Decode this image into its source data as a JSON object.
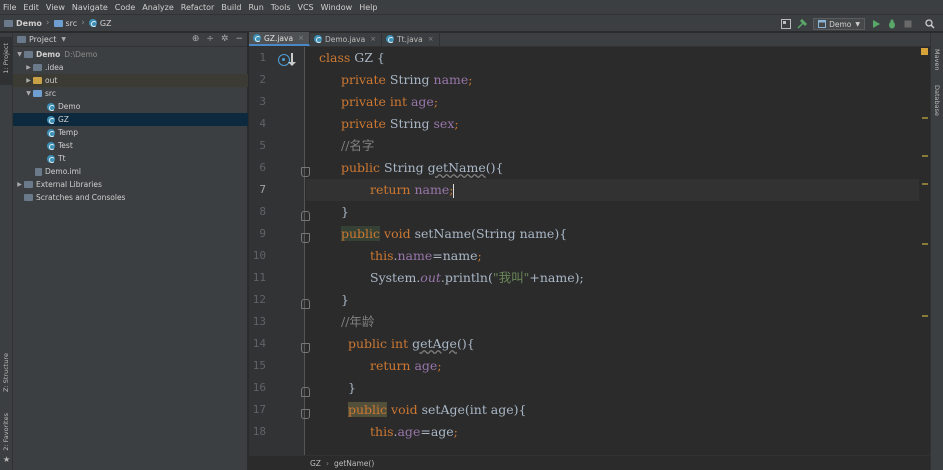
{
  "menu": [
    "File",
    "Edit",
    "View",
    "Navigate",
    "Code",
    "Analyze",
    "Refactor",
    "Build",
    "Run",
    "Tools",
    "VCS",
    "Window",
    "Help"
  ],
  "navbar": {
    "crumbs": [
      "Demo",
      "src",
      "GZ"
    ],
    "run_config": "Demo"
  },
  "left_stripe": {
    "project": "1: Project",
    "structure": "Z: Structure",
    "favorites": "2: Favorites"
  },
  "right_stripe": {
    "maven": "Maven",
    "database": "Database"
  },
  "project_panel": {
    "title": "Project",
    "tree": {
      "root": "Demo",
      "root_path": "D:\\Demo",
      "idea": ".idea",
      "out": "out",
      "src": "src",
      "files": [
        "Demo",
        "GZ",
        "Temp",
        "Test",
        "Tt"
      ],
      "iml": "Demo.iml",
      "ext": "External Libraries",
      "scratch": "Scratches and Consoles"
    }
  },
  "tabs": [
    "GZ.java",
    "Demo.java",
    "Tt.java"
  ],
  "line_numbers": [
    "1",
    "2",
    "3",
    "4",
    "5",
    "6",
    "7",
    "8",
    "9",
    "10",
    "11",
    "12",
    "13",
    "14",
    "15",
    "16",
    "17",
    "18"
  ],
  "code": {
    "class_kw": "class",
    "class_name": " GZ {",
    "private": "private",
    "public": "public",
    "int": "int",
    "void": "void",
    "return": "return",
    "string": "String",
    "this": "this",
    "name": "name",
    "age": "age",
    "sex": "sex",
    "semi": ";",
    "open_brace": "{",
    "close_brace": "}",
    "c_name": "//名字",
    "c_age": "//年龄",
    "getName": "getName",
    "setName": "setName",
    "getAge": "getAge",
    "setAge": "setAge",
    "empty_parens": "()",
    "param_name": "(String name)",
    "param_age": "(int age)",
    "assign_name": "=name",
    "assign_age": "=age",
    "dot": ".",
    "system": "System.",
    "out": "out",
    "println": ".println(",
    "str_literal": "\"我叫\"",
    "concat": "+name);"
  },
  "breadcrumb_bottom": [
    "GZ",
    "getName()"
  ]
}
